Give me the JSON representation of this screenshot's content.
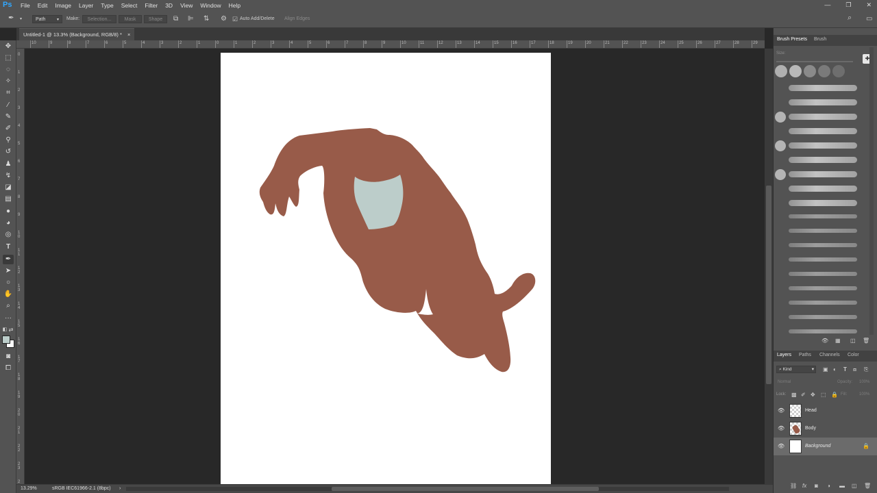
{
  "app": {
    "logo": "Ps",
    "accent": "#31a8ff"
  },
  "menu": [
    "File",
    "Edit",
    "Image",
    "Layer",
    "Type",
    "Select",
    "Filter",
    "3D",
    "View",
    "Window",
    "Help"
  ],
  "window_controls": {
    "minimize": "—",
    "restore": "❐",
    "close": "✕"
  },
  "options_bar": {
    "mode": "Path",
    "make_label": "Make:",
    "selection": "Selection...",
    "mask": "Mask",
    "shape": "Shape",
    "auto_add_delete": "Auto Add/Delete",
    "align_edges": "Align Edges"
  },
  "document": {
    "tab_title": "Untitled-1 @ 13.3% (Background, RGB/8) *",
    "close": "×",
    "zoom": "13.29%",
    "color_profile": "sRGB IEC61966-2.1 (8bpc)"
  },
  "rulers": {
    "top": [
      "10",
      "9",
      "8",
      "7",
      "6",
      "5",
      "4",
      "3",
      "2",
      "1",
      "0",
      "1",
      "2",
      "3",
      "4",
      "5",
      "6",
      "7",
      "8",
      "9",
      "10",
      "11",
      "12",
      "13",
      "14",
      "15",
      "16",
      "17",
      "18",
      "19",
      "20",
      "21",
      "22",
      "23",
      "24",
      "25",
      "26",
      "27",
      "28",
      "29"
    ],
    "left": [
      "0",
      "1",
      "2",
      "3",
      "4",
      "5",
      "6",
      "7",
      "8",
      "9",
      "1\n0",
      "1\n1",
      "1\n2",
      "1\n3",
      "1\n4",
      "1\n5",
      "1\n6",
      "1\n7",
      "1\n8",
      "1\n9",
      "2\n0",
      "2\n1",
      "2\n2",
      "2\n3",
      "2\n4"
    ]
  },
  "artwork": {
    "body_color": "#985b49",
    "head_color": "#bccdca",
    "paper_color": "#ffffff"
  },
  "brush_panel": {
    "tabs": [
      "Brush Presets",
      "Brush"
    ],
    "size_label": "Size:"
  },
  "layers_panel": {
    "tabs": [
      "Layers",
      "Paths",
      "Channels",
      "Color"
    ],
    "filter_kind": "Kind",
    "blend_mode": "Normal",
    "opacity_label": "Opacity:",
    "opacity_value": "100%",
    "lock_label": "Lock:",
    "fill_label": "Fill:",
    "fill_value": "100%",
    "layers": [
      {
        "name": "Head"
      },
      {
        "name": "Body"
      },
      {
        "name": "Background"
      }
    ]
  },
  "colors": {
    "foreground": "#bccdca",
    "background": "#ffffff"
  }
}
